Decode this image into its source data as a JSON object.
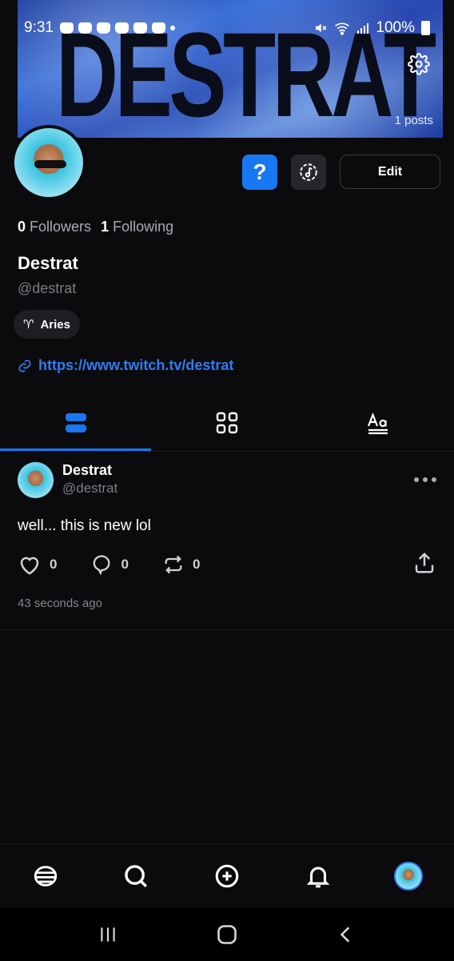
{
  "status_bar": {
    "time": "9:31",
    "battery": "100%"
  },
  "banner": {
    "text": "DESTRAT",
    "posts_label": "1 posts"
  },
  "actions": {
    "help_label": "?",
    "edit_label": "Edit"
  },
  "profile": {
    "followers_count": "0",
    "followers_label": "Followers",
    "following_count": "1",
    "following_label": "Following",
    "display_name": "Destrat",
    "handle": "@destrat",
    "zodiac_symbol": "♈",
    "zodiac": "Aries",
    "link": "https://www.twitch.tv/destrat"
  },
  "tabs": [
    {
      "name": "posts-list",
      "active": true
    },
    {
      "name": "grid",
      "active": false
    },
    {
      "name": "text",
      "active": false
    }
  ],
  "post": {
    "author": "Destrat",
    "handle": "@destrat",
    "text": "well... this is new lol",
    "likes": "0",
    "comments": "0",
    "reposts": "0",
    "timestamp": "43 seconds ago"
  },
  "colors": {
    "accent": "#1877f2",
    "link": "#2f7cf6",
    "background": "#0b0b0d"
  },
  "bottom_nav": [
    "home-icon",
    "search-icon",
    "add-icon",
    "bell-icon",
    "profile-avatar"
  ]
}
